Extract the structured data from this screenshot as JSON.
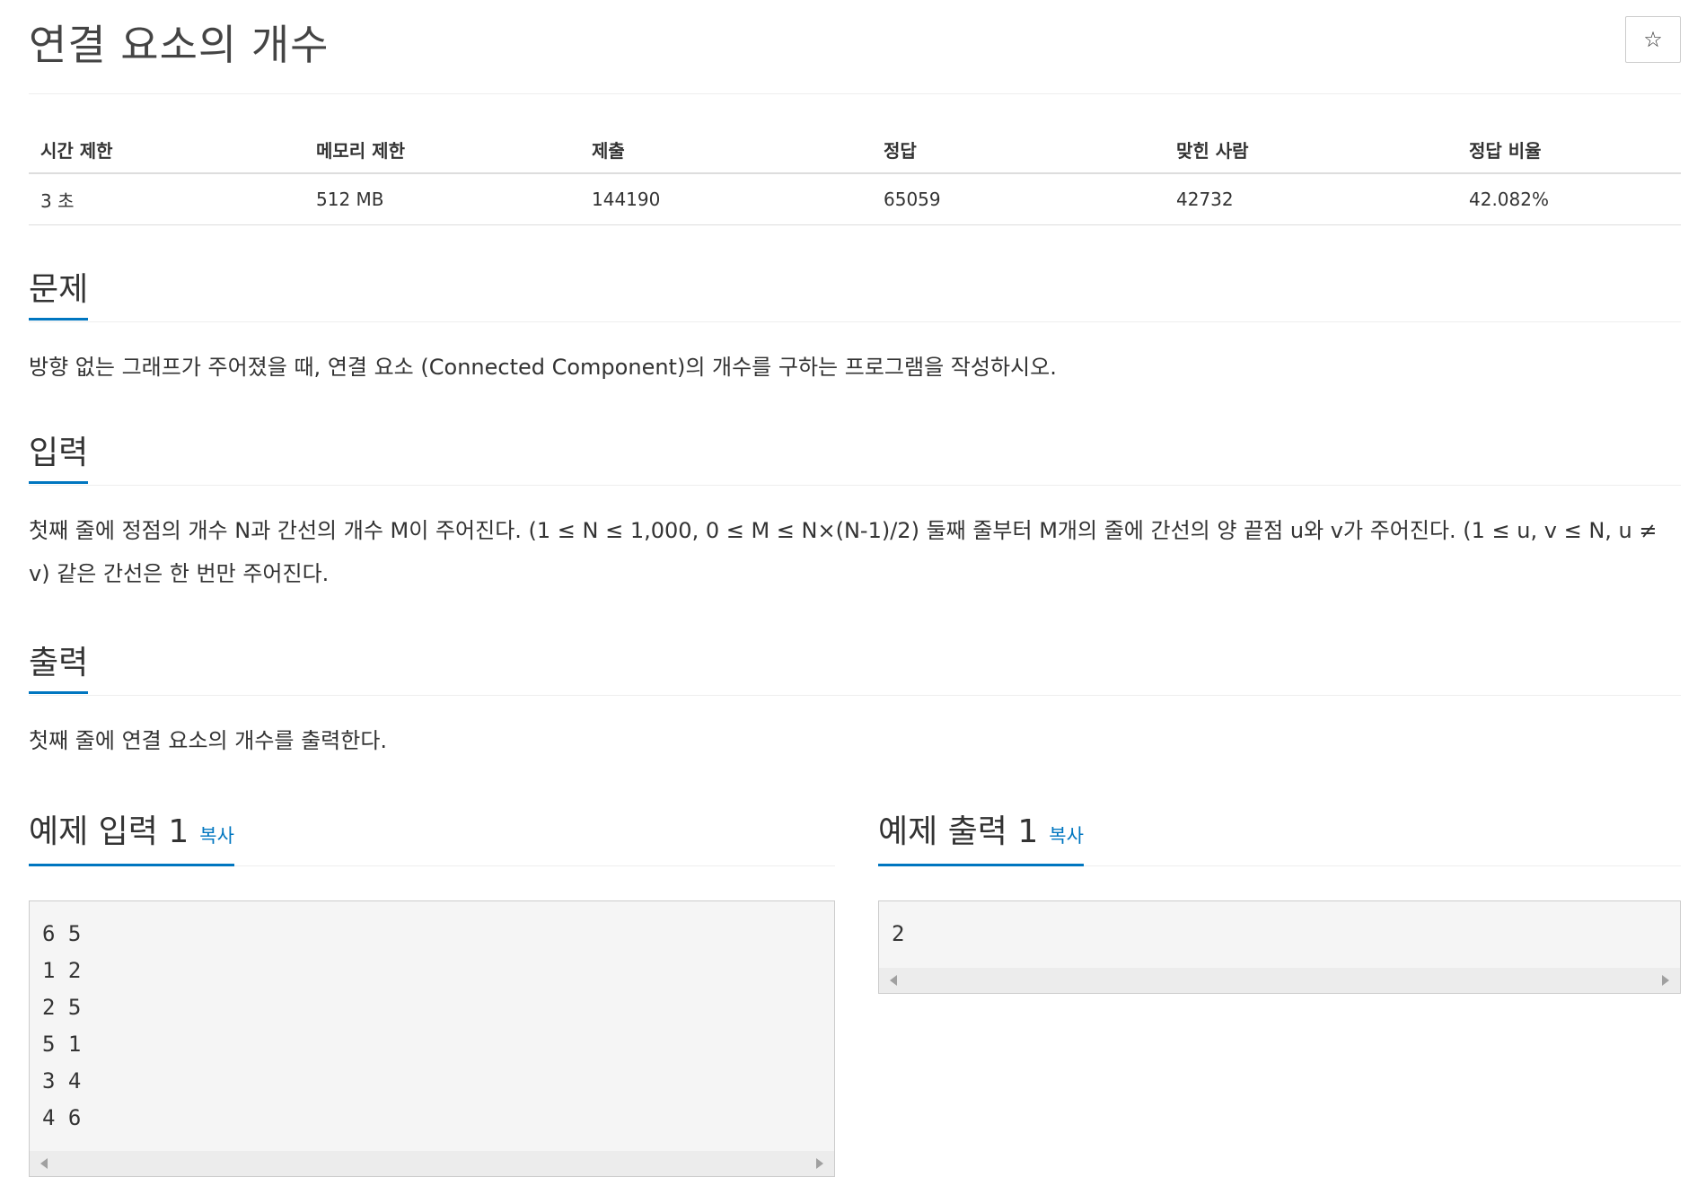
{
  "problem": {
    "title": "연결 요소의 개수",
    "star_icon": "☆"
  },
  "stats": {
    "headers": [
      "시간 제한",
      "메모리 제한",
      "제출",
      "정답",
      "맞힌 사람",
      "정답 비율"
    ],
    "values": [
      "3 초",
      "512 MB",
      "144190",
      "65059",
      "42732",
      "42.082%"
    ]
  },
  "sections": {
    "description": {
      "title": "문제",
      "text": "방향 없는 그래프가 주어졌을 때, 연결 요소 (Connected Component)의 개수를 구하는 프로그램을 작성하시오."
    },
    "input": {
      "title": "입력",
      "text": "첫째 줄에 정점의 개수 N과 간선의 개수 M이 주어진다. (1 ≤ N ≤ 1,000, 0 ≤ M ≤ N×(N-1)/2) 둘째 줄부터 M개의 줄에 간선의 양 끝점 u와 v가 주어진다. (1 ≤ u, v ≤ N, u ≠ v) 같은 간선은 한 번만 주어진다."
    },
    "output": {
      "title": "출력",
      "text": "첫째 줄에 연결 요소의 개수를 출력한다."
    }
  },
  "samples": {
    "input": {
      "title": "예제 입력 1",
      "copy_label": "복사",
      "content": "6 5\n1 2\n2 5\n5 1\n3 4\n4 6"
    },
    "output": {
      "title": "예제 출력 1",
      "copy_label": "복사",
      "content": "2"
    }
  }
}
